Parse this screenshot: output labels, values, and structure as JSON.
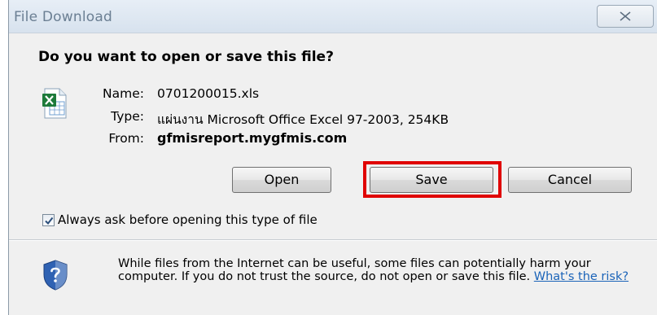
{
  "dialog": {
    "title": "File Download",
    "question": "Do you want to open or save this file?"
  },
  "file": {
    "name_label": "Name:",
    "name_value": "0701200015.xls",
    "type_label": "Type:",
    "type_value": "แผ่นงาน Microsoft Office Excel 97-2003, 254KB",
    "from_label": "From:",
    "from_value": "gfmisreport.mygfmis.com"
  },
  "buttons": {
    "open": "Open",
    "save": "Save",
    "cancel": "Cancel"
  },
  "checkbox": {
    "label": "Always ask before opening this type of file",
    "checked": true
  },
  "warning": {
    "text": "While files from the Internet can be useful, some files can potentially harm your computer. If you do not trust the source, do not open or save this file.",
    "link": "What's the risk?"
  },
  "icons": [
    "close-icon",
    "excel-file-icon",
    "checkmark-icon",
    "security-shield-icon"
  ],
  "colors": {
    "highlight": "#e00000",
    "link": "#1a63b8"
  }
}
